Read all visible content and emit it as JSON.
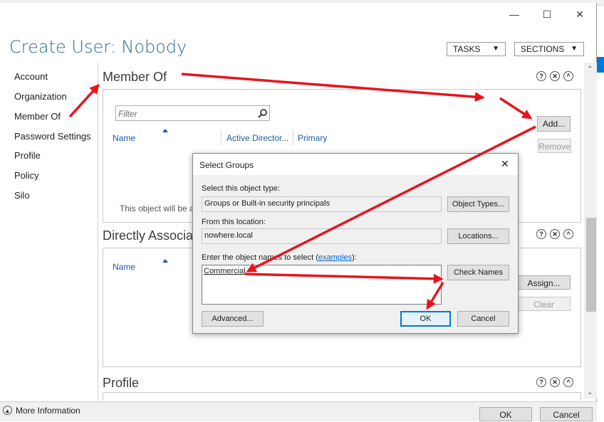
{
  "window": {
    "minimize": "—",
    "maximize": "☐",
    "close": "✕",
    "title": "Create User: Nobody"
  },
  "toolbar": {
    "tasks_label": "TASKS",
    "sections_label": "SECTIONS",
    "caret": "▼"
  },
  "nav": {
    "items": [
      {
        "label": "Account"
      },
      {
        "label": "Organization"
      },
      {
        "label": "Member Of"
      },
      {
        "label": "Password Settings"
      },
      {
        "label": "Profile"
      },
      {
        "label": "Policy"
      },
      {
        "label": "Silo"
      }
    ]
  },
  "member_of": {
    "title": "Member Of",
    "filter_placeholder": "Filter",
    "columns": [
      "Name",
      "Active Director...",
      "Primary"
    ],
    "add_label": "Add...",
    "remove_label": "Remove",
    "footer_text": "This object will be a"
  },
  "directly_associated": {
    "title": "Directly Associat",
    "columns": [
      "Name"
    ],
    "assign_label": "Assign...",
    "clear_label": "Clear"
  },
  "profile": {
    "title": "Profile"
  },
  "section_icons": {
    "help": "?",
    "close": "✕",
    "collapse": "^"
  },
  "dialog": {
    "title": "Select Groups",
    "close": "✕",
    "object_type_label": "Select this object type:",
    "object_type_value": "Groups or Built-in security principals",
    "object_types_button": "Object Types...",
    "location_label": "From this location:",
    "location_value": "nowhere.local",
    "locations_button": "Locations...",
    "names_label": "Enter the object names to select (",
    "names_link": "examples",
    "names_label_end": "):",
    "names_value": "Commercial",
    "check_names_button": "Check Names",
    "advanced_button": "Advanced...",
    "ok_button": "OK",
    "cancel_button": "Cancel"
  },
  "bottom": {
    "more_info": "More Information",
    "ok_button": "OK",
    "cancel_button": "Cancel"
  },
  "colors": {
    "title_blue": "#2a6b8f",
    "arrow_red": "#e8141c",
    "link_blue": "#0066cc"
  }
}
